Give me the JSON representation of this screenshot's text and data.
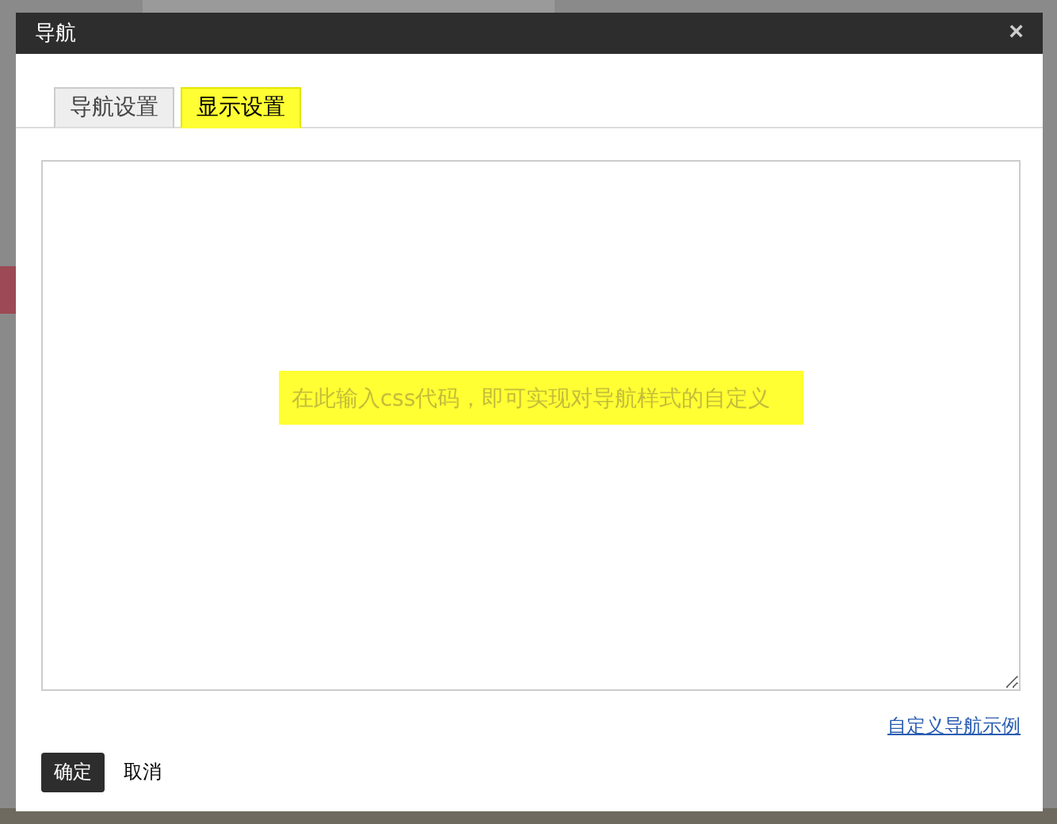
{
  "dialog": {
    "title": "导航",
    "close": "×"
  },
  "tabs": [
    {
      "label": "导航设置",
      "selected": false
    },
    {
      "label": "显示设置",
      "selected": true
    }
  ],
  "editor": {
    "placeholder": "在此输入css代码，即可实现对导航样式的自定义"
  },
  "example_link": "自定义导航示例",
  "buttons": [
    {
      "label": "确定",
      "kind": "primary"
    },
    {
      "label": "取消",
      "kind": "plain"
    }
  ]
}
